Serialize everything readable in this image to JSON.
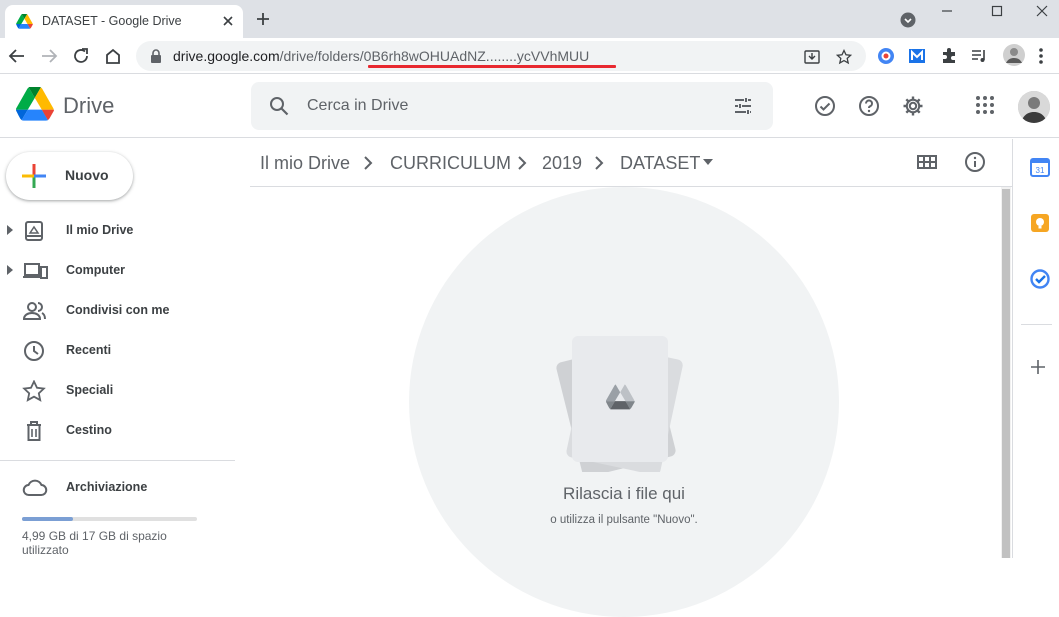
{
  "browser": {
    "tab_title": "DATASET - Google Drive",
    "url_host": "drive.google.com",
    "url_path": "/drive/folders/0B6rh8wOHUAdNZ........ycVVhMUU"
  },
  "drive": {
    "app_name": "Drive",
    "search_placeholder": "Cerca in Drive"
  },
  "sidebar": {
    "new_label": "Nuovo",
    "items": [
      {
        "label": "Il mio Drive",
        "icon": "my-drive-icon"
      },
      {
        "label": "Computer",
        "icon": "computer-icon"
      },
      {
        "label": "Condivisi con me",
        "icon": "shared-icon"
      },
      {
        "label": "Recenti",
        "icon": "recent-icon"
      },
      {
        "label": "Speciali",
        "icon": "star-icon"
      },
      {
        "label": "Cestino",
        "icon": "trash-icon"
      }
    ],
    "storage_label": "Archiviazione",
    "storage_text": "4,99 GB di 17 GB di spazio utilizzato",
    "storage_fraction": 0.29
  },
  "breadcrumb": [
    "Il mio Drive",
    "CURRICULUM",
    "2019",
    "DATASET"
  ],
  "dropzone": {
    "title": "Rilascia i file qui",
    "subtitle": "o utilizza il pulsante \"Nuovo\"."
  },
  "colors": {
    "accent_red": "#e8282f",
    "drive_blue": "#4285f4",
    "drive_green": "#0f9d58",
    "drive_yellow": "#f4b400"
  }
}
